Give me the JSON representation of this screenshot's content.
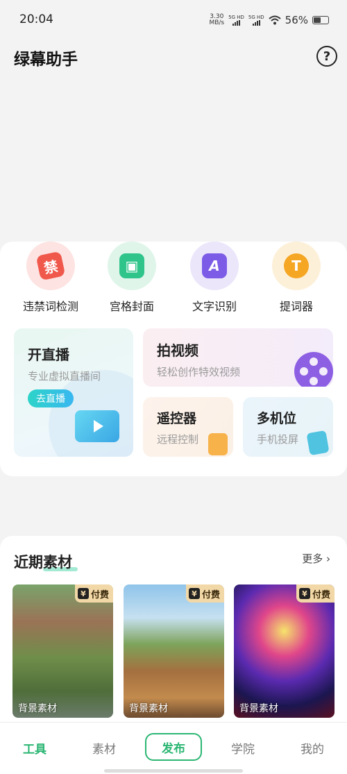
{
  "status_bar": {
    "time": "20:04",
    "net_speed_value": "3.30",
    "net_speed_unit": "MB/s",
    "sim1": "5G HD",
    "sim2": "5G HD",
    "battery": "56%"
  },
  "header": {
    "title": "绿幕助手",
    "help_icon": "?"
  },
  "quick_tools": [
    {
      "label": "违禁词检测",
      "glyph": "禁",
      "icon": "forbidden-word-icon",
      "color": "#f0584c"
    },
    {
      "label": "宫格封面",
      "glyph": "▣",
      "icon": "image-grid-icon",
      "color": "#2ec48a"
    },
    {
      "label": "文字识别",
      "glyph": "A",
      "icon": "text-recognition-icon",
      "color": "#7c5be6"
    },
    {
      "label": "提词器",
      "glyph": "T",
      "icon": "teleprompter-icon",
      "color": "#f5a623"
    }
  ],
  "features": {
    "live": {
      "title": "开直播",
      "subtitle": "专业虚拟直播间",
      "button": "去直播"
    },
    "shoot": {
      "title": "拍视频",
      "subtitle": "轻松创作特效视频"
    },
    "remote": {
      "title": "遥控器",
      "subtitle": "远程控制"
    },
    "multi": {
      "title": "多机位",
      "subtitle": "手机投屏"
    }
  },
  "recent": {
    "title": "近期素材",
    "more": "更多",
    "items": [
      {
        "badge": "付费",
        "label": "背景素材"
      },
      {
        "badge": "付费",
        "label": "背景素材"
      },
      {
        "badge": "付费",
        "label": "背景素材"
      }
    ]
  },
  "nav": {
    "tools": "工具",
    "materials": "素材",
    "publish": "发布",
    "academy": "学院",
    "mine": "我的"
  },
  "colors": {
    "accent": "#2bb673"
  }
}
